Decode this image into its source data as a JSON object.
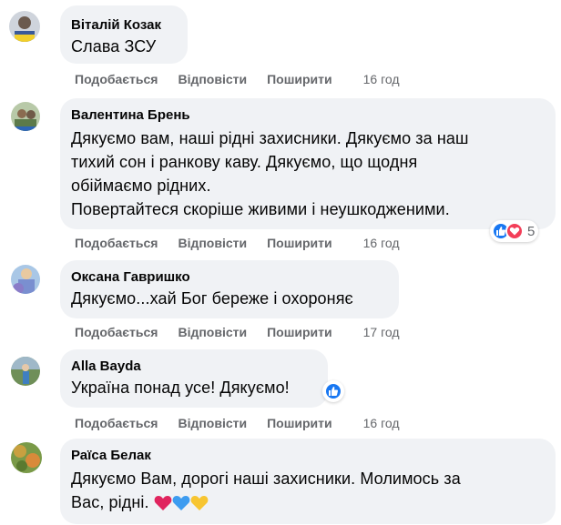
{
  "action_labels": {
    "like": "Подобається",
    "reply": "Відповісти",
    "share": "Поширити"
  },
  "comments": [
    {
      "author": "Віталій Козак",
      "text": "Слава ЗСУ",
      "time": "16 год"
    },
    {
      "author": "Валентина Брень",
      "text": "Дякуємо вам, наші рідні захисники. Дякуємо за наш\nтихий сон і ранкову каву. Дякуємо, що щодня\nобіймаємо рідних.\nПовертайтеся скоріше живими і неушкодженими.",
      "time": "16 год",
      "reactions_count": "5"
    },
    {
      "author": "Оксана Гавришко",
      "text": "Дякуємо...хай Бог береже і охороняє",
      "time": "17 год"
    },
    {
      "author": "Alla Bayda",
      "text": "Україна понад усе! Дякуємо!",
      "time": "16 год"
    },
    {
      "author": "Раїса Белак",
      "text": "Дякуємо Вам, дорогі наші захисники. Молимось за\nВас, рідні.",
      "time": ""
    }
  ],
  "colors": {
    "bubble": "#f0f2f5",
    "meta": "#65676b",
    "like": "#1877f2",
    "love": "#f33e58",
    "heart_red": "#e0245e",
    "heart_blue": "#3d9cf0",
    "heart_yellow": "#f7c531"
  },
  "icons": [
    "like-icon",
    "love-icon",
    "red-heart-icon",
    "blue-heart-icon",
    "yellow-heart-icon"
  ]
}
